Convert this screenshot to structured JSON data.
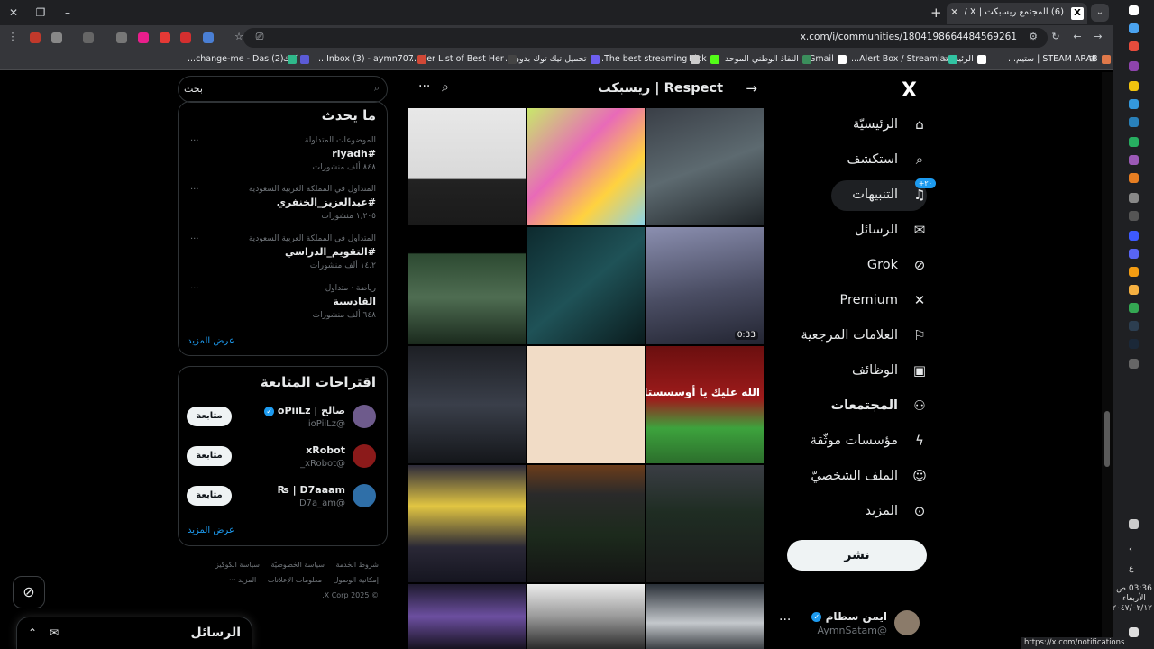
{
  "browser": {
    "tab_title": "(6) المجتمع ريسبكت | Respect / X",
    "tab_favicon": "X",
    "url": "x.com/i/communities/1804198664484569261",
    "status_url": "https://x.com/notifications",
    "bookmarks": [
      "STEAM ARAB | ستيم...",
      "الرئيسيّة",
      "Alert Box / Streamla...",
      "Gmail",
      "النفاذ الوطني الموحد",
      "Kick",
      "The best streaming...",
      "تحميل تيك توك بدون...",
      "Tier List of Best Her...",
      "Inbox (3) - aymn707...",
      "كيك",
      "(2) change-me - Das..."
    ],
    "clock": {
      "time": "03:36 ص",
      "day": "الأربعاء",
      "date": "٢٠٤٧/٠٢/١٢"
    }
  },
  "nav": {
    "logo": "X",
    "items": [
      {
        "label": "الرئيسيّة",
        "icon": "home-icon"
      },
      {
        "label": "استكشف",
        "icon": "search-icon"
      },
      {
        "label": "التنبيهات",
        "icon": "bell-icon",
        "badge": "٢٠+"
      },
      {
        "label": "الرسائل",
        "icon": "mail-icon"
      },
      {
        "label": "Grok",
        "icon": "grok-icon"
      },
      {
        "label": "Premium",
        "icon": "x-icon"
      },
      {
        "label": "العلامات المرجعية",
        "icon": "bookmark-icon"
      },
      {
        "label": "الوظائف",
        "icon": "briefcase-icon"
      },
      {
        "label": "المجتمعات",
        "icon": "communities-icon"
      },
      {
        "label": "مؤسسات موثّقة",
        "icon": "lightning-icon"
      },
      {
        "label": "الملف الشخصيّ",
        "icon": "person-icon"
      },
      {
        "label": "المزيد",
        "icon": "more-circle-icon"
      }
    ],
    "post_label": "نشر",
    "profile": {
      "name": "ايمن سطام",
      "handle": "@AymnSatam",
      "more": "···"
    }
  },
  "community": {
    "title": "Respect | ريسبكت",
    "video_duration": "0:33",
    "overlay_text": "الله عليك يا أوسسستاا"
  },
  "sidebar": {
    "search_placeholder": "بحث",
    "trends_title": "ما يحدث",
    "trends": [
      {
        "context": "الموضوعات المتداولة",
        "name": "#riyadh",
        "count": "٨٤٨ ألف منشورات"
      },
      {
        "context": "المتداول في المملكة العربية السعودية",
        "name": "#عبدالعزيز_الخنفري",
        "count": "١,٢٠٥ منشورات"
      },
      {
        "context": "المتداول في المملكة العربية السعودية",
        "name": "#التقويم_الدراسي",
        "count": "١٤.٢ ألف منشورات"
      },
      {
        "context": "رياضة · متداول",
        "name": "القادسية",
        "count": "٦٤٨ ألف منشورات"
      }
    ],
    "trends_more": "عرض المزيد",
    "follow_title": "اقتراحات المتابعة",
    "follow": [
      {
        "name": "صالح | oPiiLz",
        "handle": "@ioPiiLz",
        "button": "متابعة",
        "verified": true
      },
      {
        "name": "xRobot",
        "handle": "@xRobot_",
        "button": "متابعة",
        "verified": false
      },
      {
        "name": "D7aaam | ₨",
        "handle": "@D7a_am",
        "button": "متابعة",
        "verified": false
      }
    ],
    "follow_more": "عرض المزيد",
    "footer": [
      "شروط الخدمة",
      "سياسة الخصوصيّة",
      "سياسة الكوكيز",
      "إمكانية الوصول",
      "معلومات الإعلانات",
      "المزيد ···",
      "© 2025 X Corp."
    ]
  },
  "messages_drawer": {
    "title": "الرسائل"
  },
  "colors": {
    "accent": "#1d9bf0",
    "background": "#000000",
    "border": "#2f3336",
    "muted": "#71767b"
  }
}
